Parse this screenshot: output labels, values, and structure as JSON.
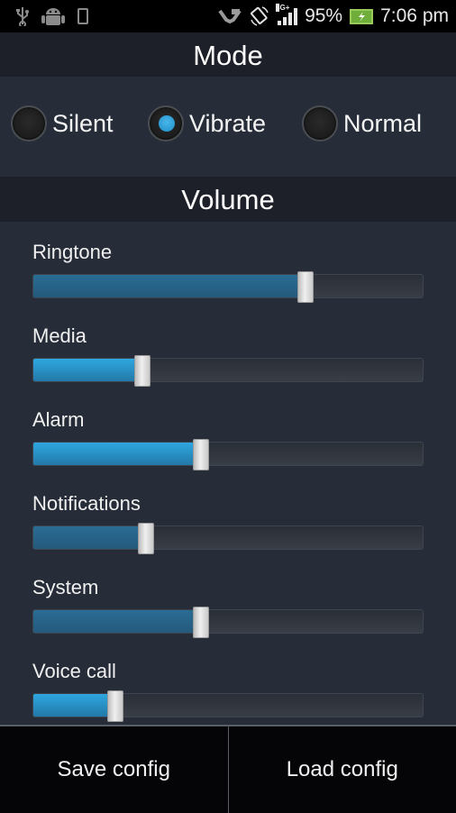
{
  "status_bar": {
    "left_icons": [
      "usb-icon",
      "android-debug-icon",
      "phone-device-icon"
    ],
    "right_icons": [
      "hands-icon",
      "screen-rotation-icon",
      "signal-icon",
      "battery-charging-icon"
    ],
    "network_type": "3G+",
    "battery_percent": "95%",
    "time": "7:06 pm"
  },
  "mode": {
    "title": "Mode",
    "options": [
      {
        "label": "Silent",
        "checked": false
      },
      {
        "label": "Vibrate",
        "checked": true
      },
      {
        "label": "Normal",
        "checked": false
      }
    ],
    "accent_color": "#2a9ad6"
  },
  "volume": {
    "title": "Volume",
    "sliders": [
      {
        "label": "Ringtone",
        "value_fraction": 0.7,
        "active": false
      },
      {
        "label": "Media",
        "value_fraction": 0.28,
        "active": true
      },
      {
        "label": "Alarm",
        "value_fraction": 0.43,
        "active": true
      },
      {
        "label": "Notifications",
        "value_fraction": 0.29,
        "active": false
      },
      {
        "label": "System",
        "value_fraction": 0.43,
        "active": false
      },
      {
        "label": "Voice call",
        "value_fraction": 0.21,
        "active": true
      }
    ]
  },
  "actions": {
    "save_label": "Save config",
    "load_label": "Load config"
  }
}
